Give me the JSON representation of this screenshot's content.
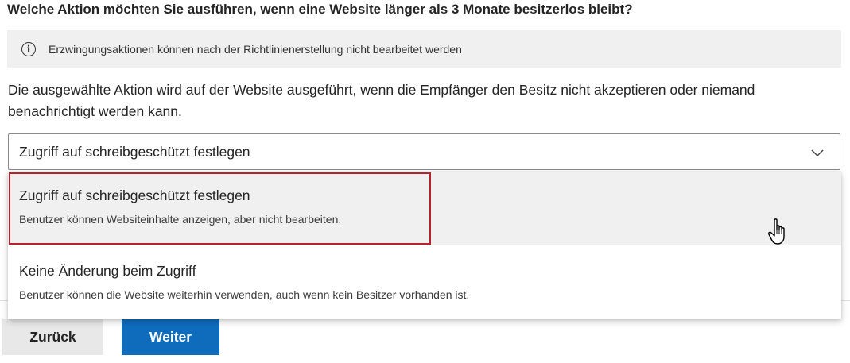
{
  "question": "Welche Aktion möchten Sie ausführen, wenn eine Website länger als 3 Monate besitzerlos bleibt?",
  "info": {
    "icon": "info-icon",
    "text": "Erzwingungsaktionen können nach der Richtlinienerstellung nicht bearbeitet werden"
  },
  "description": "Die ausgewählte Aktion wird auf der Website ausgeführt, wenn die Empfänger den Besitz nicht akzeptieren oder niemand benachrichtigt werden kann.",
  "select": {
    "value": "Zugriff auf schreibgeschützt festlegen",
    "icon": "chevron-down-icon"
  },
  "options": [
    {
      "title": "Zugriff auf schreibgeschützt festlegen",
      "subtitle": "Benutzer können Websiteinhalte anzeigen, aber nicht bearbeiten."
    },
    {
      "title": "Keine Änderung beim Zugriff",
      "subtitle": "Benutzer können die Website weiterhin verwenden, auch wenn kein Besitzer vorhanden ist."
    }
  ],
  "buttons": {
    "back": "Zurück",
    "next": "Weiter"
  },
  "colors": {
    "primary": "#0f6cbd",
    "highlight": "#b7222d",
    "hover": "#f0f0f0"
  }
}
